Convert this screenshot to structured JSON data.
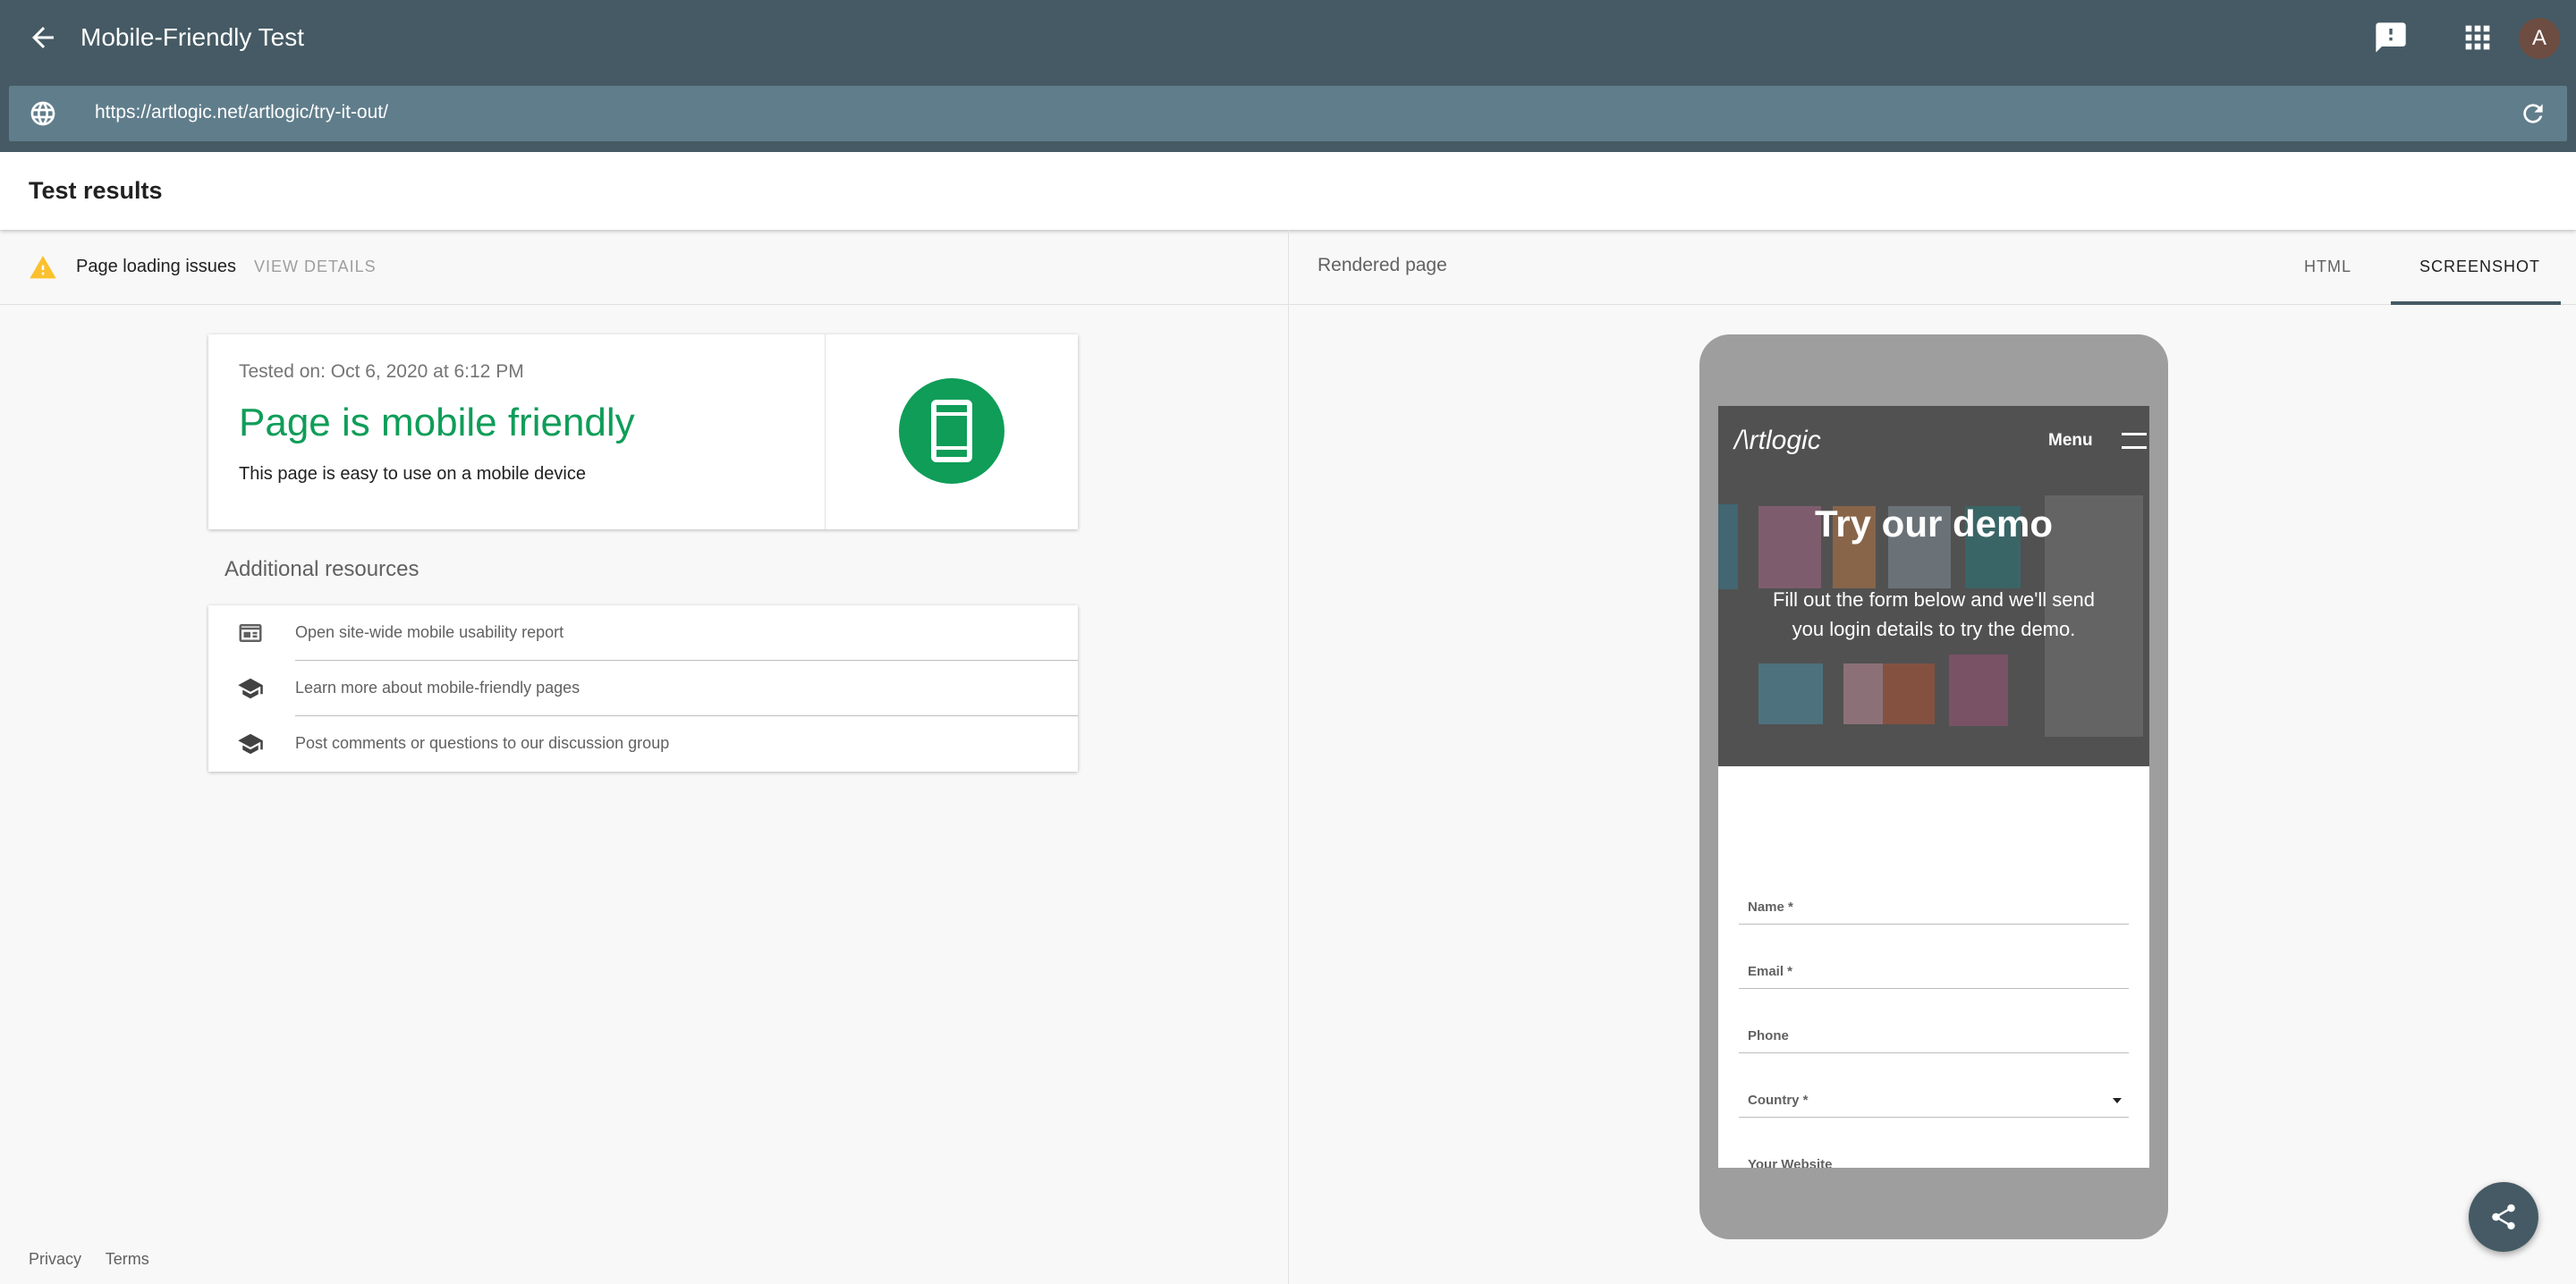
{
  "app": {
    "title": "Mobile-Friendly Test",
    "avatar_letter": "A"
  },
  "urlbar": {
    "url": "https://artlogic.net/artlogic/try-it-out/"
  },
  "results": {
    "heading": "Test results"
  },
  "issues": {
    "text": "Page loading issues",
    "action": "VIEW DETAILS"
  },
  "verdict": {
    "tested_on": "Tested on: Oct 6, 2020 at 6:12 PM",
    "headline": "Page is mobile friendly",
    "subtext": "This page is easy to use on a mobile device",
    "color": "#0f9d58"
  },
  "resources": {
    "heading": "Additional resources",
    "items": [
      {
        "label": "Open site-wide mobile usability report",
        "icon": "report-icon"
      },
      {
        "label": "Learn more about mobile-friendly pages",
        "icon": "school-icon"
      },
      {
        "label": "Post comments or questions to our discussion group",
        "icon": "school-icon"
      }
    ]
  },
  "footer": {
    "privacy": "Privacy",
    "terms": "Terms"
  },
  "rendered": {
    "title": "Rendered page",
    "tabs": [
      {
        "label": "HTML",
        "active": false
      },
      {
        "label": "SCREENSHOT",
        "active": true
      }
    ]
  },
  "preview": {
    "logo": "/\\rtlogic",
    "menu": "Menu",
    "heading": "Try our demo",
    "paragraph": "Fill out the form below and we'll send you login details to try the demo.",
    "fields": [
      "Name *",
      "Email *",
      "Phone",
      "Country *",
      "Your Website"
    ]
  },
  "colors": {
    "appbar": "#455a64",
    "urlbar": "#607d8b",
    "accent_green": "#0f9d58",
    "warning": "#fbc02d"
  }
}
